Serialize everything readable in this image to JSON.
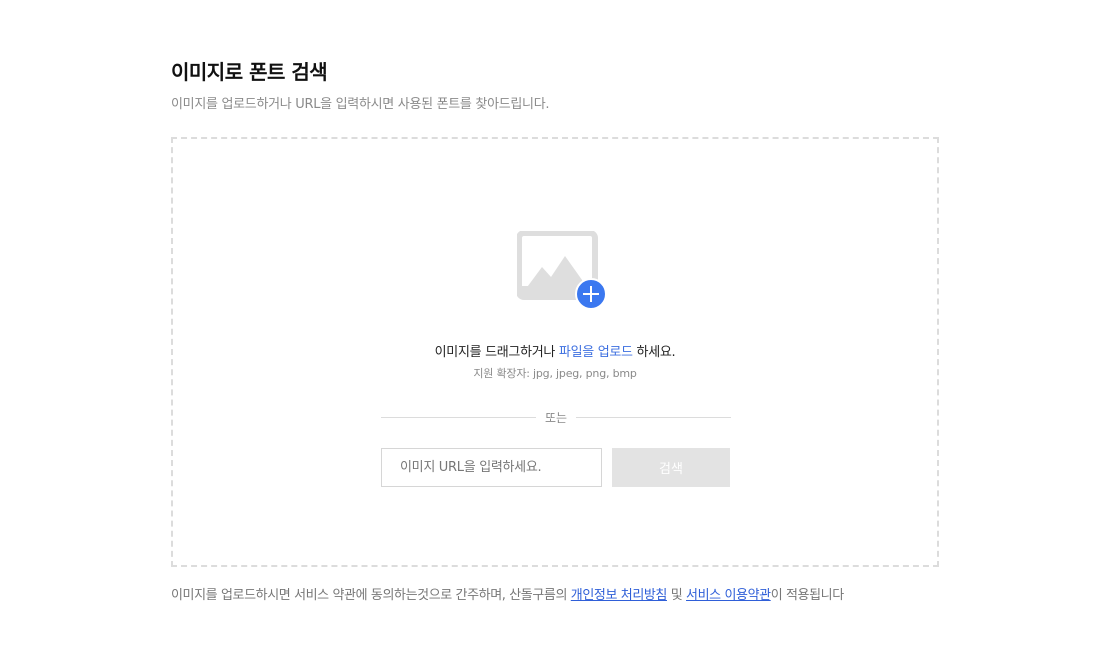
{
  "header": {
    "title": "이미지로 폰트 검색",
    "subtitle": "이미지를 업로드하거나 URL을 입력하시면 사용된 폰트를 찾아드립니다."
  },
  "dropzone": {
    "icon": "image-add-icon",
    "drag_text_prefix": "이미지를 드래그하거나 ",
    "upload_link": "파일을 업로드",
    "drag_text_suffix": " 하세요.",
    "extensions": "지원 확장자: jpg, jpeg, png, bmp",
    "or_label": "또는",
    "url_placeholder": "이미지 URL을 입력하세요.",
    "search_label": "검색"
  },
  "footer": {
    "text_prefix": "이미지를 업로드하시면 서비스 약관에 동의하는것으로 간주하며, 산돌구름의 ",
    "privacy_link": "개인정보 처리방침",
    "text_middle": " 및 ",
    "terms_link": "서비스 이용약관",
    "text_suffix": "이 적용됩니다"
  },
  "colors": {
    "accent": "#3d6fe0",
    "icon_gray": "#dedede",
    "plus_badge": "#3b78f0",
    "button_disabled": "#e3e3e3"
  }
}
